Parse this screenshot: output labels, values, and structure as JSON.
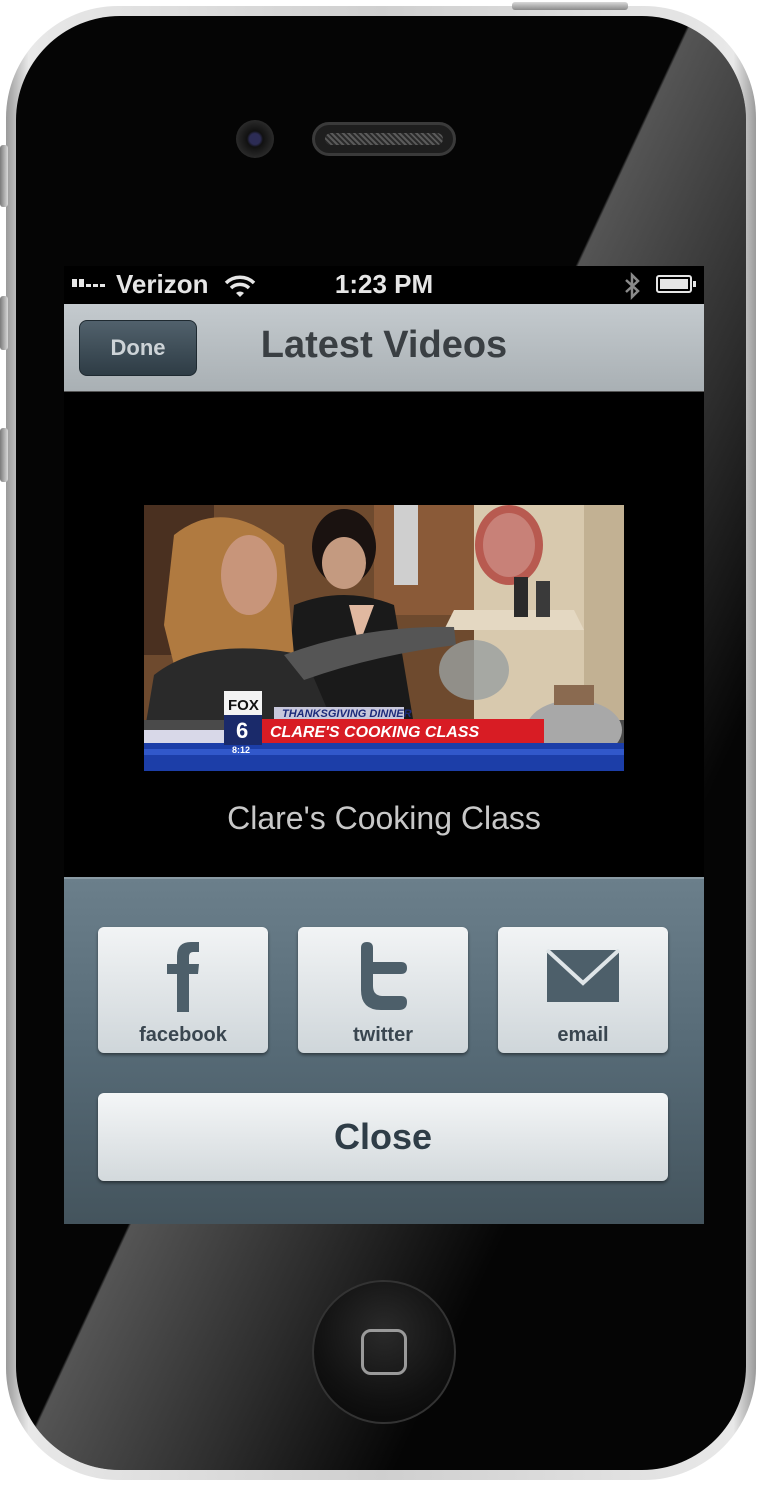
{
  "status_bar": {
    "carrier": "Verizon",
    "time": "1:23 PM"
  },
  "nav_bar": {
    "done_label": "Done",
    "title": "Latest Videos"
  },
  "video": {
    "thumbnail_overlay": {
      "network": "FOX",
      "channel": "6",
      "clock": "8:12",
      "kicker": "THANKSGIVING DINNER",
      "headline": "CLARE'S COOKING CLASS"
    },
    "caption": "Clare's Cooking Class"
  },
  "share": {
    "buttons": [
      {
        "label": "facebook",
        "icon": "facebook-icon"
      },
      {
        "label": "twitter",
        "icon": "twitter-icon"
      },
      {
        "label": "email",
        "icon": "envelope-icon"
      }
    ],
    "close_label": "Close"
  },
  "colors": {
    "nav_bar": "#b3babe",
    "share_panel": "#566a76",
    "button_text": "#2f3d47"
  }
}
